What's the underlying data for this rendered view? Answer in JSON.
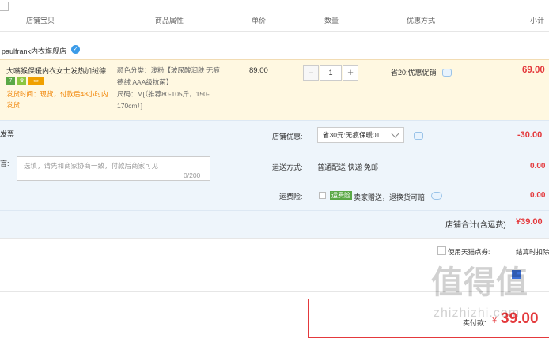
{
  "header": {
    "col_shop_item": "店铺宝贝",
    "col_attr": "商品属性",
    "col_price": "单价",
    "col_qty": "数量",
    "col_promo": "优惠方式",
    "col_subtotal": "小计"
  },
  "shop": {
    "name": "paulfrank内衣旗舰店"
  },
  "item": {
    "title": "大嘴猴保暖内衣女士发热加绒德...",
    "badge_colors": [
      "#5aa846",
      "#8cc63f",
      "#f0a000"
    ],
    "ship_note": "发货时间：现货，付款后48小时内发货",
    "attr_color": "颜色分类：浅粉【玻尿酸润肤 无痕德绒 AAA级抗菌】",
    "attr_size": "尺码：M[（推荐80-105斤，150-170cm）]",
    "price": "89.00",
    "qty": "1",
    "qty_minus": "−",
    "qty_plus": "+",
    "promo": "省20:优惠促销",
    "subtotal": "69.00",
    "accent": "#e4393c"
  },
  "summary": {
    "invoice_label": "发票",
    "message_label": "言:",
    "message_placeholder": "选填，请先和商家协商一致，付款后商家可见",
    "message_count": "0/200",
    "shop_discount_label": "店铺优惠:",
    "shop_discount_option": "省30元:无痕保暖01",
    "shop_discount_amount": "-30.00",
    "shipping_label": "运送方式:",
    "shipping_value": "普通配送 快递 免邮",
    "shipping_amount": "0.00",
    "return_ins_label": "运费险:",
    "return_ins_badge": "运费险",
    "return_ins_text": "卖家赠送，退换货可赔",
    "return_ins_amount": "0.00",
    "total_label": "店铺合计(含运费)",
    "total_amount": "¥39.00"
  },
  "bottom": {
    "tmall_points_label": "使用天猫点券:",
    "settle_label": "结算时扣除",
    "pay_label": "实付款:",
    "pay_currency": "¥",
    "pay_amount": "39.00"
  },
  "watermark": {
    "logo": "值得值",
    "url": "zhizhizhi.com"
  }
}
